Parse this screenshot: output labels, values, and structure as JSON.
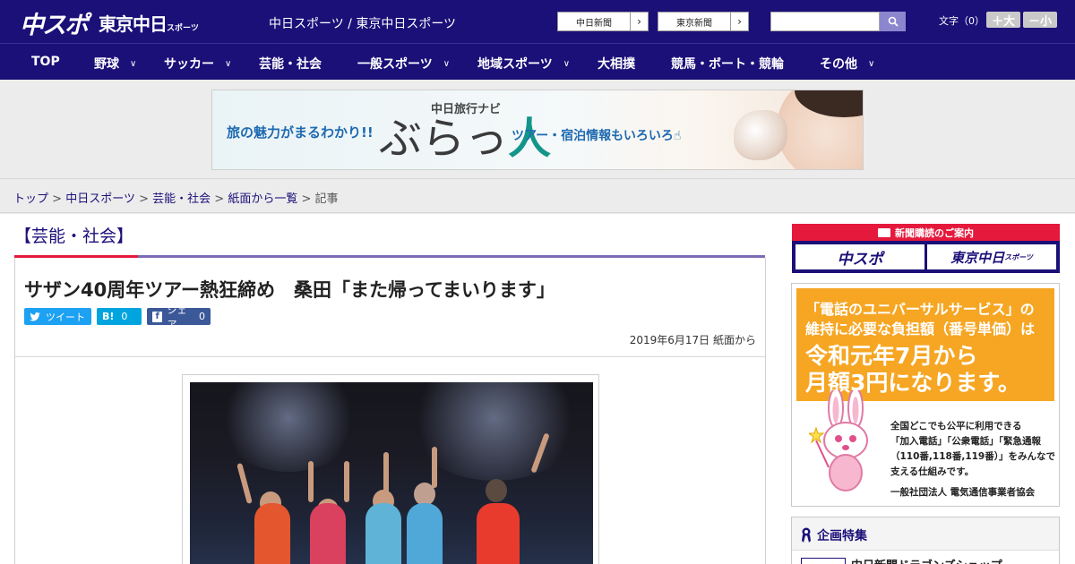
{
  "header": {
    "logo_chuspo": "中スポ",
    "logo_tokyo": "東京中日",
    "logo_tokyo_sub": "スポーツ",
    "site_name": "中日スポーツ / 東京中日スポーツ",
    "newspaper_links": [
      "中日新聞",
      "東京新聞"
    ],
    "search": {
      "placeholder": "",
      "icon": "search-icon"
    },
    "font_size": {
      "label": "文字（0）",
      "bigger": "＋大",
      "smaller": "－小"
    }
  },
  "nav": {
    "items": [
      {
        "label": "TOP",
        "dropdown": false
      },
      {
        "label": "野球",
        "dropdown": true
      },
      {
        "label": "サッカー",
        "dropdown": true
      },
      {
        "label": "芸能・社会",
        "dropdown": false
      },
      {
        "label": "一般スポーツ",
        "dropdown": true
      },
      {
        "label": "地域スポーツ",
        "dropdown": true
      },
      {
        "label": "大相撲",
        "dropdown": false
      },
      {
        "label": "競馬・ボート・競輪",
        "dropdown": false
      },
      {
        "label": "その他",
        "dropdown": true
      }
    ]
  },
  "banner": {
    "left_text": "旅の魅力がまるわかり!!",
    "brand_small": "中日旅行ナビ",
    "brand_big_a": "ぶらっ",
    "brand_big_b": "人",
    "right_text": "ツアー・宿泊情報もいろいろ"
  },
  "breadcrumb": {
    "items": [
      "トップ",
      "中日スポーツ",
      "芸能・社会",
      "紙面から一覧"
    ],
    "current": "記事",
    "separator": ">"
  },
  "article": {
    "category": "【芸能・社会】",
    "title": "サザン40周年ツアー熱狂締め　桑田「また帰ってまいります」",
    "share": {
      "tweet": "ツイート",
      "hatena_label": "B!",
      "hatena_count": "0",
      "facebook_label": "シェア",
      "facebook_count": "0"
    },
    "date": "2019年6月17日 紙面から"
  },
  "sidebar": {
    "subscribe": {
      "title": "新聞購読のご案内",
      "buttons": [
        "中スポ",
        "東京中日"
      ],
      "button2_sub": "スポーツ"
    },
    "ad": {
      "line1": "「電話のユニバーサルサービス」の",
      "line2": "維持に必要な負担額（番号単価）は",
      "line3": "令和元年7月から",
      "line4": "月額3円になります。",
      "body": [
        "全国どこでも公平に利用できる",
        "「加入電話」「公衆電話」「緊急通報",
        "（110番,118番,119番）」をみんなで",
        "支える仕組みです。"
      ],
      "org": "一般社団法人 電気通信事業者協会"
    },
    "feature": {
      "title": "企画特集",
      "first_item": "中日新聞ドラゴンズショップ"
    }
  },
  "colors": {
    "brand_navy": "#1b0f78",
    "accent_red": "#e5193c",
    "twitter": "#1da1f2",
    "hatena": "#00a4de",
    "facebook": "#3b5998",
    "ad_orange": "#f6a623"
  }
}
